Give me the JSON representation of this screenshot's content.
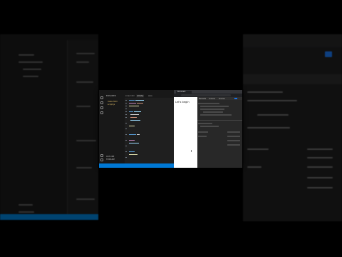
{
  "vscode": {
    "explorer_title": "EXPLORER",
    "explorer_items": [
      "index.html",
      "script.js"
    ],
    "tabs": [
      "index.html",
      "script.js",
      "style"
    ],
    "outline_label": "OUTLINE",
    "timeline_label": "TIMELINE"
  },
  "browser": {
    "tab_title": "Document",
    "page_heading": "Let's begin"
  },
  "devtools": {
    "tabs": [
      "Elements",
      "Console",
      "Sources"
    ]
  },
  "colors": {
    "accent": "#0078d4",
    "editor_bg": "#1f1f1f",
    "sidebar_bg": "#181818",
    "page_bg": "#ffffff"
  }
}
